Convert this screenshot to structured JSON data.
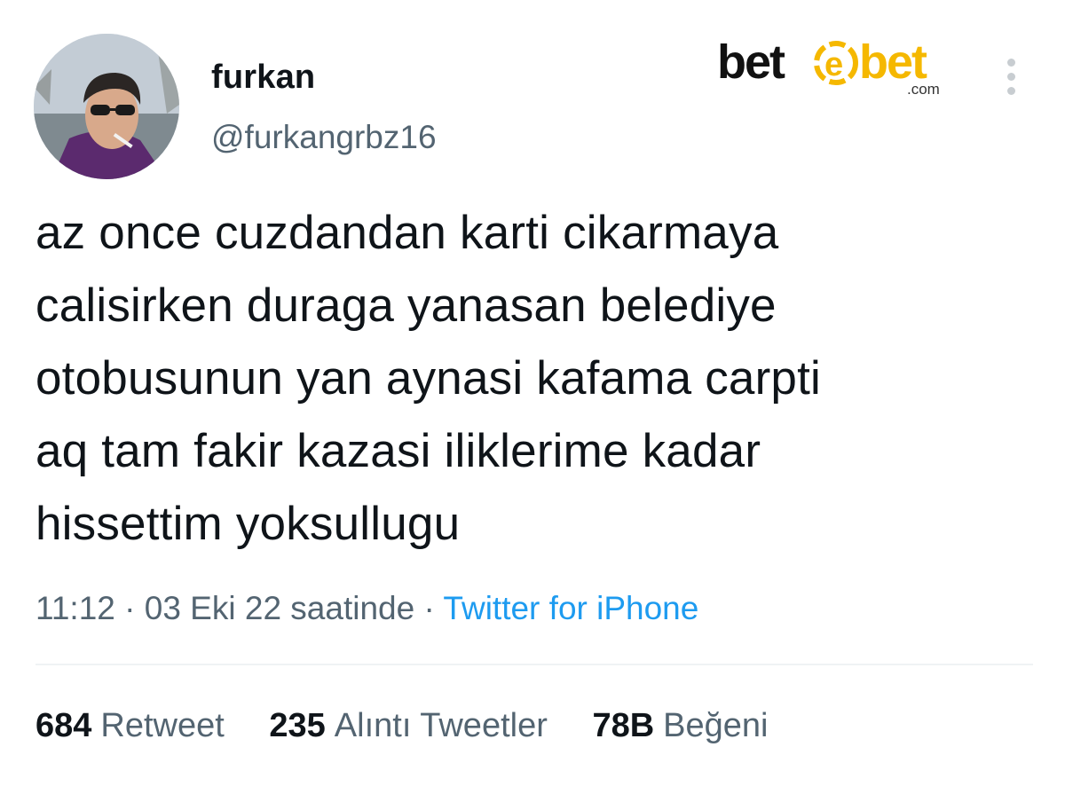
{
  "author": {
    "display_name": "furkan",
    "handle": "@furkangrbz16"
  },
  "brand": {
    "text_left": "bet",
    "text_right": "bet",
    "suffix": ".com",
    "left_color": "#111111",
    "right_color": "#f5b800"
  },
  "tweet": {
    "lines": [
      "az once cuzdandan karti cikarmaya",
      "calisirken duraga yanasan belediye",
      "otobusunun yan aynasi kafama carpti",
      "aq tam fakir kazasi iliklerime kadar",
      "hissettim yoksullugu"
    ]
  },
  "meta": {
    "time": "11:12",
    "separator": "·",
    "date": "03 Eki 22 saatinde",
    "source": "Twitter for iPhone"
  },
  "stats": {
    "retweets": {
      "count": "684",
      "label": "Retweet"
    },
    "quotes": {
      "count": "235",
      "label": "Alıntı Tweetler"
    },
    "likes": {
      "count": "78B",
      "label": "Beğeni"
    }
  },
  "colors": {
    "text": "#0f1419",
    "secondary": "#536471",
    "link": "#1d9bf0",
    "divider": "#eff3f4"
  },
  "icons": {
    "more": "more-vertical-icon"
  }
}
